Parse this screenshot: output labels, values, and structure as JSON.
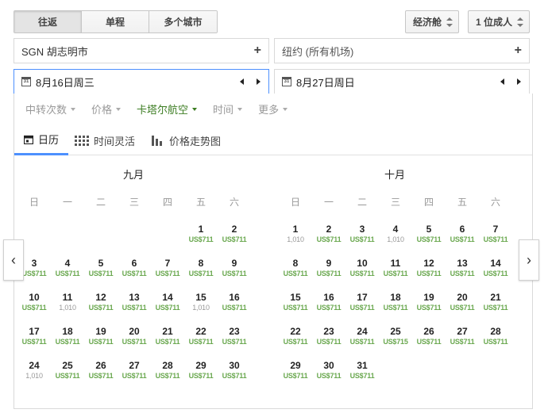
{
  "trip_types": [
    "往返",
    "单程",
    "多个城市"
  ],
  "cabin": "经济舱",
  "passengers": "1 位成人",
  "origin": "SGN 胡志明市",
  "destination": "纽约 (所有机场)",
  "depart_date": "8月16日周三",
  "return_date": "8月27日周日",
  "calendar_icon_text": "31",
  "filters": [
    "中转次数",
    "价格",
    "卡塔尔航空",
    "时间",
    "更多"
  ],
  "tabs": [
    "日历",
    "时间灵活",
    "价格走势图"
  ],
  "weekdays": [
    "日",
    "一",
    "二",
    "三",
    "四",
    "五",
    "六"
  ],
  "months": [
    {
      "title": "九月",
      "first_weekday": 5,
      "days": [
        [
          "1",
          "US$711"
        ],
        [
          "2",
          "US$711"
        ],
        [
          "3",
          "US$711"
        ],
        [
          "4",
          "US$711"
        ],
        [
          "5",
          "US$711"
        ],
        [
          "6",
          "US$711"
        ],
        [
          "7",
          "US$711"
        ],
        [
          "8",
          "US$711"
        ],
        [
          "9",
          "US$711"
        ],
        [
          "10",
          "US$711"
        ],
        [
          "11",
          "1,010"
        ],
        [
          "12",
          "US$711"
        ],
        [
          "13",
          "US$711"
        ],
        [
          "14",
          "US$711"
        ],
        [
          "15",
          "1,010"
        ],
        [
          "16",
          "US$711"
        ],
        [
          "17",
          "US$711"
        ],
        [
          "18",
          "US$711"
        ],
        [
          "19",
          "US$711"
        ],
        [
          "20",
          "US$711"
        ],
        [
          "21",
          "US$711"
        ],
        [
          "22",
          "US$711"
        ],
        [
          "23",
          "US$711"
        ],
        [
          "24",
          "1,010"
        ],
        [
          "25",
          "US$711"
        ],
        [
          "26",
          "US$711"
        ],
        [
          "27",
          "US$711"
        ],
        [
          "28",
          "US$711"
        ],
        [
          "29",
          "US$711"
        ],
        [
          "30",
          "US$711"
        ]
      ]
    },
    {
      "title": "十月",
      "first_weekday": 0,
      "days": [
        [
          "1",
          "1,010"
        ],
        [
          "2",
          "US$711"
        ],
        [
          "3",
          "US$711"
        ],
        [
          "4",
          "1,010"
        ],
        [
          "5",
          "US$711"
        ],
        [
          "6",
          "US$711"
        ],
        [
          "7",
          "US$711"
        ],
        [
          "8",
          "US$711"
        ],
        [
          "9",
          "US$711"
        ],
        [
          "10",
          "US$711"
        ],
        [
          "11",
          "US$711"
        ],
        [
          "12",
          "US$711"
        ],
        [
          "13",
          "US$711"
        ],
        [
          "14",
          "US$711"
        ],
        [
          "15",
          "US$711"
        ],
        [
          "16",
          "US$711"
        ],
        [
          "17",
          "US$711"
        ],
        [
          "18",
          "US$711"
        ],
        [
          "19",
          "US$711"
        ],
        [
          "20",
          "US$711"
        ],
        [
          "21",
          "US$711"
        ],
        [
          "22",
          "US$711"
        ],
        [
          "23",
          "US$711"
        ],
        [
          "24",
          "US$711"
        ],
        [
          "25",
          "US$715"
        ],
        [
          "26",
          "US$711"
        ],
        [
          "27",
          "US$711"
        ],
        [
          "28",
          "US$711"
        ],
        [
          "29",
          "US$711"
        ],
        [
          "30",
          "US$711"
        ],
        [
          "31",
          "US$711"
        ]
      ]
    }
  ],
  "nav": {
    "prev": "‹",
    "next": "›"
  },
  "colors": {
    "price_green": "#6aa84f",
    "accent_blue": "#4d90fe",
    "active_filter": "#3c7d22"
  }
}
